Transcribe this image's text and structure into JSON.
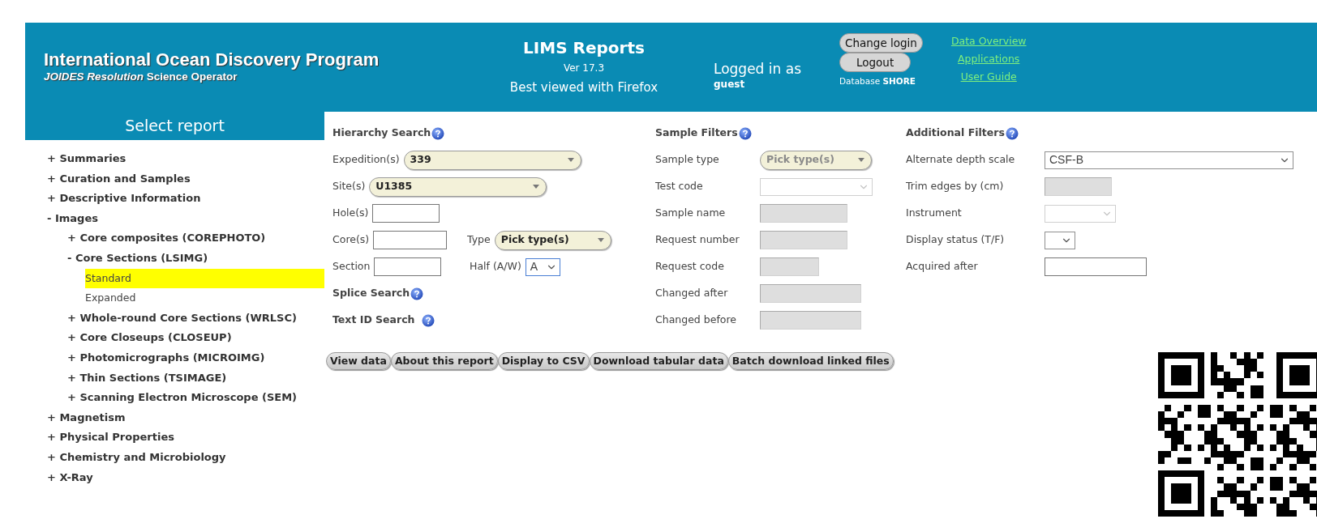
{
  "header": {
    "title": "International Ocean Discovery Program",
    "subtitle": "*JOIDES Resolution* Science Operator",
    "app_title": "LIMS Reports",
    "version": "Ver 17.3",
    "note": "Best viewed with Firefox",
    "login_label": "Logged in as",
    "user": "guest",
    "buttons": [
      "Change login",
      "Logout"
    ],
    "database": "Database **SHORE**",
    "links": [
      "Data Overview",
      "Applications",
      "User Guide"
    ]
  },
  "sidebar": {
    "title": "Select report",
    "items": [
      {
        "label": "+ Summaries",
        "selected": false
      },
      {
        "label": "+ Curation and Samples",
        "selected": false
      },
      {
        "label": "+ Descriptive Information",
        "selected": false
      },
      {
        "label": "- Images",
        "selected": false,
        "children": [
          {
            "label": "+ Core composites (COREPHOTO)",
            "selected": false
          },
          {
            "label": "- Core Sections (LSIMG)",
            "selected": false,
            "children": [
              {
                "label": "Standard",
                "selected": true
              },
              {
                "label": "Expanded",
                "selected": false
              }
            ]
          },
          {
            "label": "+ Whole-round Core Sections (WRLSC)",
            "selected": false
          },
          {
            "label": "+ Core Closeups (CLOSEUP)",
            "selected": false
          },
          {
            "label": "+ Photomicrographs (MICROIMG)",
            "selected": false
          },
          {
            "label": "+ Thin Sections (TSIMAGE)",
            "selected": false
          },
          {
            "label": "+ Scanning Electron Microscope (SEM)",
            "selected": false
          }
        ]
      },
      {
        "label": "+ Magnetism",
        "selected": false
      },
      {
        "label": "+ Physical Properties",
        "selected": false
      },
      {
        "label": "+ Chemistry and Microbiology",
        "selected": false
      },
      {
        "label": "+ X-Ray",
        "selected": false
      }
    ]
  },
  "hierarchy": {
    "title": "Hierarchy Search",
    "rows": [
      [
        {
          "label": "Expedition(s)",
          "kind": "pill",
          "value": "339",
          "disabled": false
        }
      ],
      [
        {
          "label": "Site(s)",
          "kind": "pill",
          "value": "U1385",
          "disabled": false
        }
      ],
      [
        {
          "label": "Hole(s)",
          "kind": "input"
        }
      ],
      [
        {
          "label": "Core(s)",
          "kind": "input"
        },
        {
          "label": "Type",
          "kind": "pill",
          "value": "Pick type(s)",
          "disabled": false
        }
      ],
      [
        {
          "label": "Section",
          "kind": "input"
        },
        {
          "label": "Half (A/W)",
          "kind": "select",
          "value": "A",
          "disabled": false,
          "focused": true
        }
      ]
    ],
    "sections": [
      "Splice Search",
      "Text ID Search"
    ]
  },
  "sample_filters": {
    "title": "Sample Filters",
    "rows": [
      {
        "label": "Sample type",
        "kind": "pill",
        "value": "Pick type(s)",
        "disabled": true
      },
      {
        "label": "Test code",
        "kind": "select",
        "disabled": true,
        "focused": false
      },
      {
        "label": "Sample name",
        "kind": "disabled_input"
      },
      {
        "label": "Request number",
        "kind": "disabled_input"
      },
      {
        "label": "Request code",
        "kind": "disabled_input"
      },
      {
        "label": "Changed after",
        "kind": "disabled_input"
      },
      {
        "label": "Changed before",
        "kind": "disabled_input"
      }
    ]
  },
  "additional_filters": {
    "title": "Additional Filters",
    "rows": [
      {
        "label": "Alternate depth scale",
        "kind": "select",
        "value": "CSF-B",
        "disabled": false,
        "focused": false
      },
      {
        "label": "Trim edges by (cm)",
        "kind": "disabled_input"
      },
      {
        "label": "Instrument",
        "kind": "select",
        "disabled": true,
        "focused": false
      },
      {
        "label": "Display status (T/F)",
        "kind": "select",
        "disabled": false,
        "focused": false
      },
      {
        "label": "Acquired after",
        "kind": "input"
      }
    ]
  },
  "actions": [
    "View data",
    "About this report",
    "Display to CSV",
    "Download tabular data",
    "Batch download linked files"
  ]
}
